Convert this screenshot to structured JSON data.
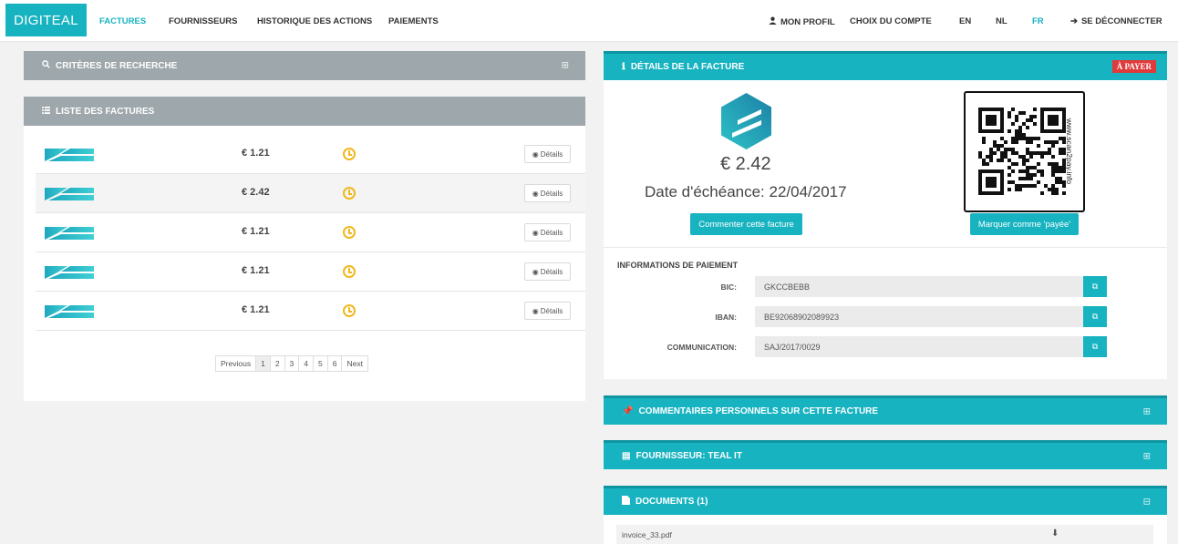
{
  "navbar": {
    "brand": "DIGITEAL",
    "links": [
      "FACTURES",
      "FOURNISSEURS",
      "HISTORIQUE DES ACTIONS",
      "PAIEMENTS"
    ],
    "profile": "MON PROFIL",
    "account": "CHOIX DU COMPTE",
    "languages": [
      "EN",
      "NL",
      "FR"
    ],
    "active_language": "FR",
    "logout": "SE DÉCONNECTER"
  },
  "search_panel": {
    "title": "CRITÈRES DE RECHERCHE",
    "toggle": "⊞"
  },
  "list_panel": {
    "title": "LISTE DES FACTURES",
    "rows": [
      {
        "amount": "€ 1.21",
        "details": "Détails"
      },
      {
        "amount": "€ 2.42",
        "details": "Détails"
      },
      {
        "amount": "€ 1.21",
        "details": "Détails"
      },
      {
        "amount": "€ 1.21",
        "details": "Détails"
      },
      {
        "amount": "€ 1.21",
        "details": "Détails"
      }
    ],
    "selected_row": 1,
    "pagination": [
      "Previous",
      "1",
      "2",
      "3",
      "4",
      "5",
      "6",
      "Next"
    ]
  },
  "details_panel": {
    "title": "DÉTAILS DE LA FACTURE",
    "status": "À PAYER",
    "amount": "€ 2.42",
    "due_date": "Date d'échéance: 22/04/2017",
    "comment_button": "Commenter cette facture",
    "mark_paid_button": "Marquer comme 'payée'",
    "qr_side_text": "www.scan2pay.info",
    "payment_info_title": "INFORMATIONS DE PAIEMENT",
    "bic_label": "BIC:",
    "bic": "GKCCBEBB",
    "iban_label": "IBAN:",
    "iban": "BE92068902089923",
    "communication_label": "COMMUNICATION:",
    "communication": "SAJ/2017/0029"
  },
  "comments_panel": {
    "title": "COMMENTAIRES PERSONNELS SUR CETTE FACTURE",
    "toggle": "⊞"
  },
  "supplier_panel": {
    "title": "FOURNISSEUR: TEAL IT",
    "toggle": "⊞"
  },
  "documents_panel": {
    "title": "DOCUMENTS (1)",
    "toggle": "⊟",
    "files": [
      "invoice_33.pdf"
    ]
  },
  "colors": {
    "accent": "#17b3c0",
    "gray_header": "#9ea7ab",
    "status": "#e03a3a",
    "pending": "#f0b81c"
  }
}
